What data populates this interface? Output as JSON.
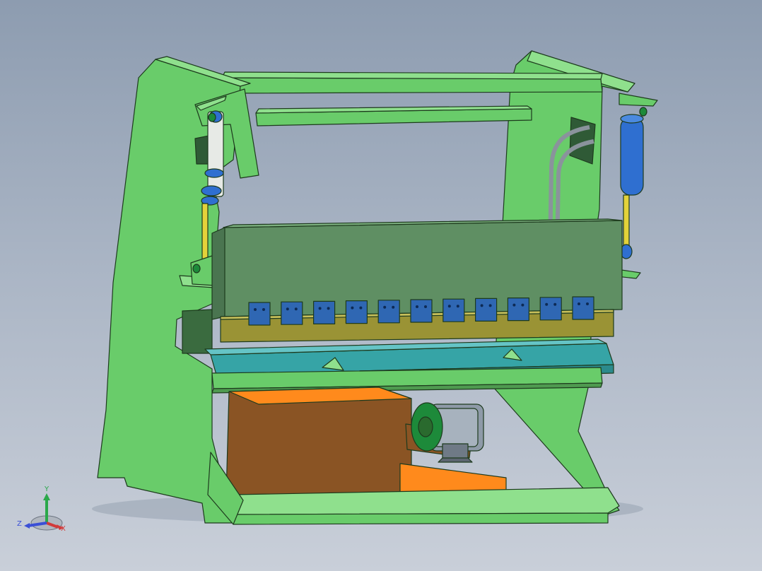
{
  "viewport": {
    "background_top": "#8d9cb0",
    "background_bottom": "#c9cfd9"
  },
  "model": {
    "colors": {
      "frame": "#69cc6a",
      "frame_light": "#8fe08d",
      "frame_edge": "#1d3a1d",
      "ram_plate": "#5f8f63",
      "blade_bar": "#9a9335",
      "clamp_block": "#2f67b3",
      "worktable": "#36a4a6",
      "hydraulic_tank": "#8a5424",
      "tank_top": "#ff8a1c",
      "motor": "#8e9aa8",
      "motor_flange": "#1d8a3a",
      "cylinder": "#2f6fd0",
      "piston_rod": "#e3d23a",
      "pipe": "#b5bcc4"
    },
    "clamp_count": 11
  },
  "triad": {
    "x_label": "X",
    "y_label": "Y",
    "z_label": "Z",
    "x_color": "#d23a3a",
    "y_color": "#2aa84a",
    "z_color": "#3a4fd6"
  }
}
